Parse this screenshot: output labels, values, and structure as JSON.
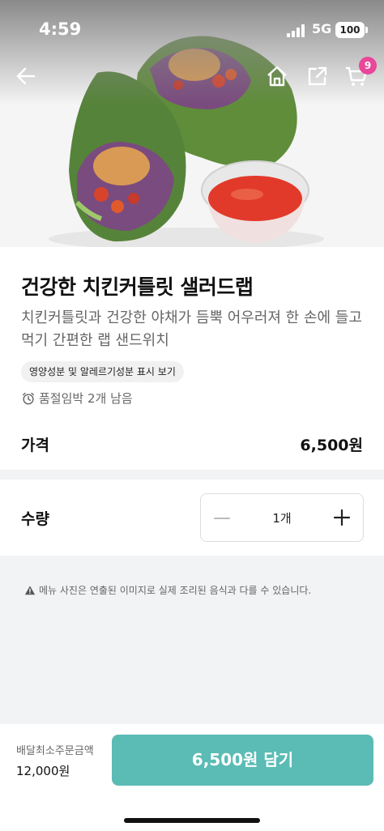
{
  "status_bar": {
    "time": "4:59",
    "network": "5G",
    "battery": "100"
  },
  "header": {
    "cart_count": "9"
  },
  "product": {
    "title": "건강한 치킨커틀릿 샐러드랩",
    "description": "치킨커틀릿과 건강한 야채가 듬뿍 어우러져 한 손에 들고 먹기 간편한 랩 샌드위치",
    "nutrition_link": "영양성분 및 알레르기성분 표시 보기",
    "stock_notice": "품절임박 2개 남음",
    "price_label": "가격",
    "price_value": "6,500원"
  },
  "quantity": {
    "label": "수량",
    "value": "1개"
  },
  "notice": "메뉴 사진은 연출된 이미지로 실제 조리된 음식과 다를 수 있습니다.",
  "footer": {
    "min_order_label": "배달최소주문금액",
    "min_order_value": "12,000원",
    "add_button": "6,500원 담기"
  },
  "colors": {
    "accent": "#5bbbb5",
    "badge": "#e8479a"
  },
  "icons": [
    "back-arrow-icon",
    "home-icon",
    "share-icon",
    "cart-icon",
    "alarm-clock-icon",
    "minus-icon",
    "plus-icon",
    "warning-icon"
  ]
}
